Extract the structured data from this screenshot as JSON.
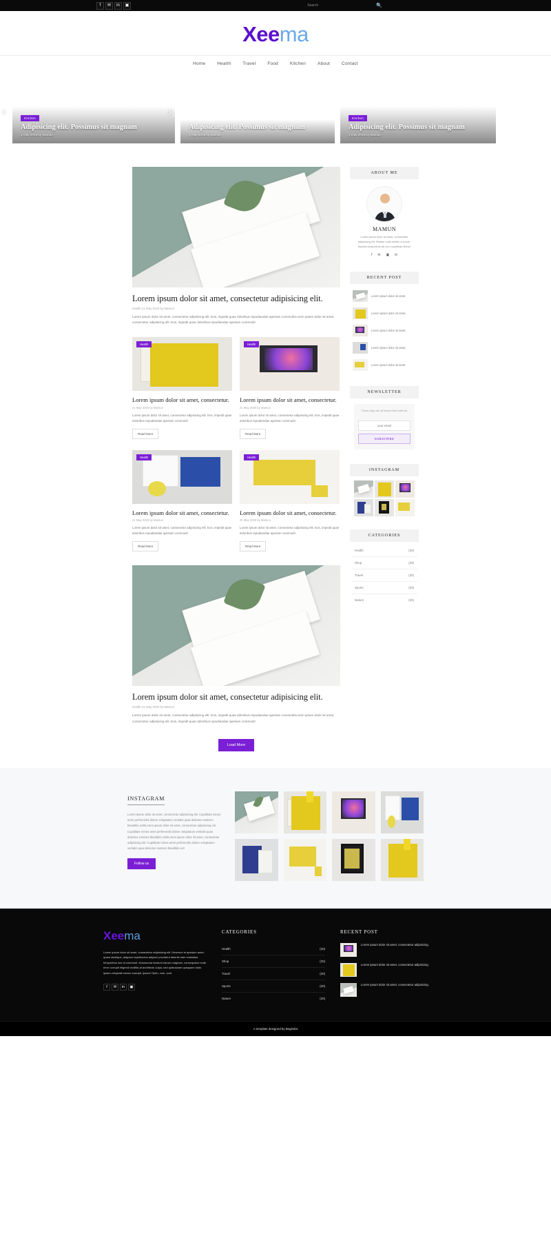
{
  "topbar": {
    "social": [
      {
        "name": "facebook-icon",
        "glyph": "f"
      },
      {
        "name": "twitter-icon",
        "glyph": "✉"
      },
      {
        "name": "linkedin-icon",
        "glyph": "in"
      },
      {
        "name": "instagram-icon",
        "glyph": "▣"
      }
    ],
    "search_placeholder": "Search",
    "search_value": ""
  },
  "header": {
    "logo_part1": "Xee",
    "logo_part2": "ma",
    "nav": [
      "Home",
      "Health",
      "Travel",
      "Food",
      "Kitchen",
      "About",
      "Contact"
    ]
  },
  "slider": {
    "prev": "‹",
    "next": "›",
    "slides": [
      {
        "badge": "Kitchen",
        "title": "Adipisicing elit. Possimus sit magnam",
        "meta": "1 may 2019 by Mamun"
      },
      {
        "badge": "",
        "title": "Adipisicing elit. Possimus sit magnam",
        "meta": "1 may 2019 by Mamun"
      },
      {
        "badge": "Kitchen",
        "title": "Adipisicing elit. Possimus sit magnam",
        "meta": "1 may 2019 by Mamun"
      }
    ]
  },
  "main": {
    "featured_top": {
      "title": "Lorem ipsum dolor sit amet, consectetur adipisicing elit.",
      "meta": "Health 21 May 2020 by Mamun",
      "text": "Lorem ipsum dolor sit amet, consectetur adipisicing elit. Eos, impedit quae doloribus repudiandae aperiam commodi!Lorem ipsum dolor sit amet, consectetur adipisicing elit. Eos, impedit quae doloribus repudiandae aperiam commodi!"
    },
    "cards": [
      {
        "badge": "Health",
        "title": "Lorem ipsum dolor sit amet, consectetur.",
        "meta": "21 May 2020 by Mamun",
        "text": "Lorem ipsum dolor sit amet, consectetur adipisicing elit. Eos, impedit quae doloribus repudiandae aperiam commodi!",
        "button": "Read More"
      },
      {
        "badge": "Health",
        "title": "Lorem ipsum dolor sit amet, consectetur.",
        "meta": "21 May 2020 by Mamun",
        "text": "Lorem ipsum dolor sit amet, consectetur adipisicing elit. Eos, impedit quae doloribus repudiandae aperiam commodi!",
        "button": "Read More"
      },
      {
        "badge": "Health",
        "title": "Lorem ipsum dolor sit amet, consectetur.",
        "meta": "21 May 2020 by Mamun",
        "text": "Lorem ipsum dolor sit amet, consectetur adipisicing elit. Eos, impedit quae doloribus repudiandae aperiam commodi!",
        "button": "Read More"
      },
      {
        "badge": "Health",
        "title": "Lorem ipsum dolor sit amet, consectetur.",
        "meta": "21 May 2020 by Mamun",
        "text": "Lorem ipsum dolor sit amet, consectetur adipisicing elit. Eos, impedit quae doloribus repudiandae aperiam commodi!",
        "button": "Read More"
      }
    ],
    "featured_bottom": {
      "title": "Lorem ipsum dolor sit amet, consectetur adipisicing elit.",
      "meta": "Health 21 May 2020 by Mamun",
      "text": "Lorem ipsum dolor sit amet, consectetur adipisicing elit. Eos, impedit quae doloribus repudiandae aperiam commodi!Lorem ipsum dolor sit amet, consectetur adipisicing elit. Eos, impedit quae doloribus repudiandae aperiam commodi!"
    },
    "load_more": "Load More"
  },
  "sidebar": {
    "about": {
      "heading": "ABOUT ME",
      "name": "MAMUN",
      "text": "Lorem ipsum dolor sit amet, consectetur adipisicing elit. Beatae nulla debitis a dolore, repellat temporibus ab vero cupiditate libero!",
      "social": [
        {
          "name": "facebook-icon",
          "glyph": "f"
        },
        {
          "name": "twitter-icon",
          "glyph": "✉"
        },
        {
          "name": "instagram-icon",
          "glyph": "▣"
        },
        {
          "name": "linkedin-icon",
          "glyph": "in"
        }
      ]
    },
    "recent_post": {
      "heading": "RECENT POST",
      "items": [
        {
          "text": "Lorem ipsum dolor sit amet."
        },
        {
          "text": "Lorem ipsum dolor sit amet."
        },
        {
          "text": "Lorem ipsum dolor sit amet."
        },
        {
          "text": "Lorem ipsum dolor sit amet."
        },
        {
          "text": "Lorem ipsum dolor sit amet."
        }
      ]
    },
    "newsletter": {
      "heading": "NEWSLETTER",
      "text": "These days are all share them with me",
      "input_placeholder": "your email",
      "input_value": "",
      "button": "SUBSCRIBE"
    },
    "instagram": {
      "heading": "INSTAGRAM"
    },
    "categories": {
      "heading": "CATEGORIES",
      "items": [
        {
          "label": "Health",
          "count": "(20)"
        },
        {
          "label": "Shop",
          "count": "(20)"
        },
        {
          "label": "Travel",
          "count": "(20)"
        },
        {
          "label": "Sports",
          "count": "(20)"
        },
        {
          "label": "Nature",
          "count": "(20)"
        }
      ]
    }
  },
  "instagram_section": {
    "title": "INSTAGRAM",
    "text": "Lorem ipsum dolor sit amet, consectetur adipisicing elit. Cupiditate minus amet perferendis dolore voluptatum veritatis quas delectus nostrum blanditiis velit!Lorem ipsum dolor sit amet, consectetur adipisicing elit. Cupiditate minus amet perferendis dolore voluptatum veritatis quas delectus nostrum blanditiis velit!Lorem ipsum dolor sit amet, consectetur adipisicing elit. Cupiditate minus amet perferendis dolore voluptatum veritatis quas delectus nostrum blanditiis vel!",
    "button": "Follow us"
  },
  "footer": {
    "logo_part1": "Xee",
    "logo_part2": "ma",
    "text": "Lorem ipsum dolor sit amet, consectetur adipisicing elit. Deserunt et aperiam amet, quam similique, aliquam repellendus adipisci provident deleniti nam molestias temporibus iure id commodi. eiusmunda incidunt earum magnam, consequatur unde error corrupti eligendi mollitia at architecto culpa, sed quibusdam quisquam iusto ipsam voluptate harum suscipit, ipsam! Optio, cum, sunt.",
    "social": [
      {
        "name": "facebook-icon",
        "glyph": "f"
      },
      {
        "name": "twitter-icon",
        "glyph": "✉"
      },
      {
        "name": "linkedin-icon",
        "glyph": "in"
      },
      {
        "name": "instagram-icon",
        "glyph": "▣"
      }
    ],
    "categories": {
      "heading": "CATEGORIES",
      "items": [
        {
          "label": "Health",
          "count": "(20)"
        },
        {
          "label": "Shop",
          "count": "(20)"
        },
        {
          "label": "Travel",
          "count": "(20)"
        },
        {
          "label": "Sports",
          "count": "(20)"
        },
        {
          "label": "Nature",
          "count": "(20)"
        }
      ]
    },
    "recent_post": {
      "heading": "RECENT POST",
      "items": [
        {
          "text": "Lorem ipsum dolor sit amet, consectetur adipisicing."
        },
        {
          "text": "Lorem ipsum dolor sit amet, consectetur adipisicing."
        },
        {
          "text": "Lorem ipsum dolor sit amet, consectetur adipisicing."
        }
      ]
    },
    "copyright": "A template designed by Begindot"
  },
  "colors": {
    "accent": "#7b1fd6",
    "logo_blue": "#6aa9e9",
    "dark": "#090909",
    "light_bg": "#f7f8fa"
  }
}
